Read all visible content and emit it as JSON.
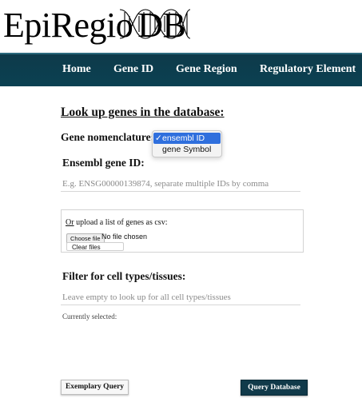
{
  "logo": {
    "text_part1": "EpiRegio",
    "text_part2": "DB"
  },
  "nav": {
    "items": [
      {
        "label": "Home"
      },
      {
        "label": "Gene ID"
      },
      {
        "label": "Gene Region"
      },
      {
        "label": "Regulatory Element"
      }
    ]
  },
  "form": {
    "heading": "Look up genes in the database:",
    "nomenclature_label": "Gene nomenclature:",
    "nomenclature_options": [
      {
        "label": "ensembl ID",
        "selected": true
      },
      {
        "label": "gene Symbol",
        "selected": false
      }
    ],
    "check_mark": "✓",
    "gene_id_label": "Ensembl gene ID:",
    "gene_id_placeholder": "E.g. ENSG00000139874, separate multiple IDs by comma",
    "gene_id_value": "",
    "upload": {
      "or": "Or",
      "text": " upload a list of genes as csv:",
      "choose_label": "Choose file",
      "status": "No file chosen",
      "clear_label": "Clear files"
    },
    "filter_label": "Filter for cell types/tissues:",
    "filter_placeholder": "Leave empty to look up for all cell types/tissues",
    "filter_value": "",
    "currently_selected": "Currently selected:",
    "exemplary_button": "Exemplary Query",
    "query_button": "Query Database"
  },
  "colors": {
    "navbar": "#0e3a4a",
    "query_button": "#113a4a",
    "selected_option": "#2f6fdd"
  },
  "icons": {
    "logo_decoration": "dna-helix-icon"
  }
}
